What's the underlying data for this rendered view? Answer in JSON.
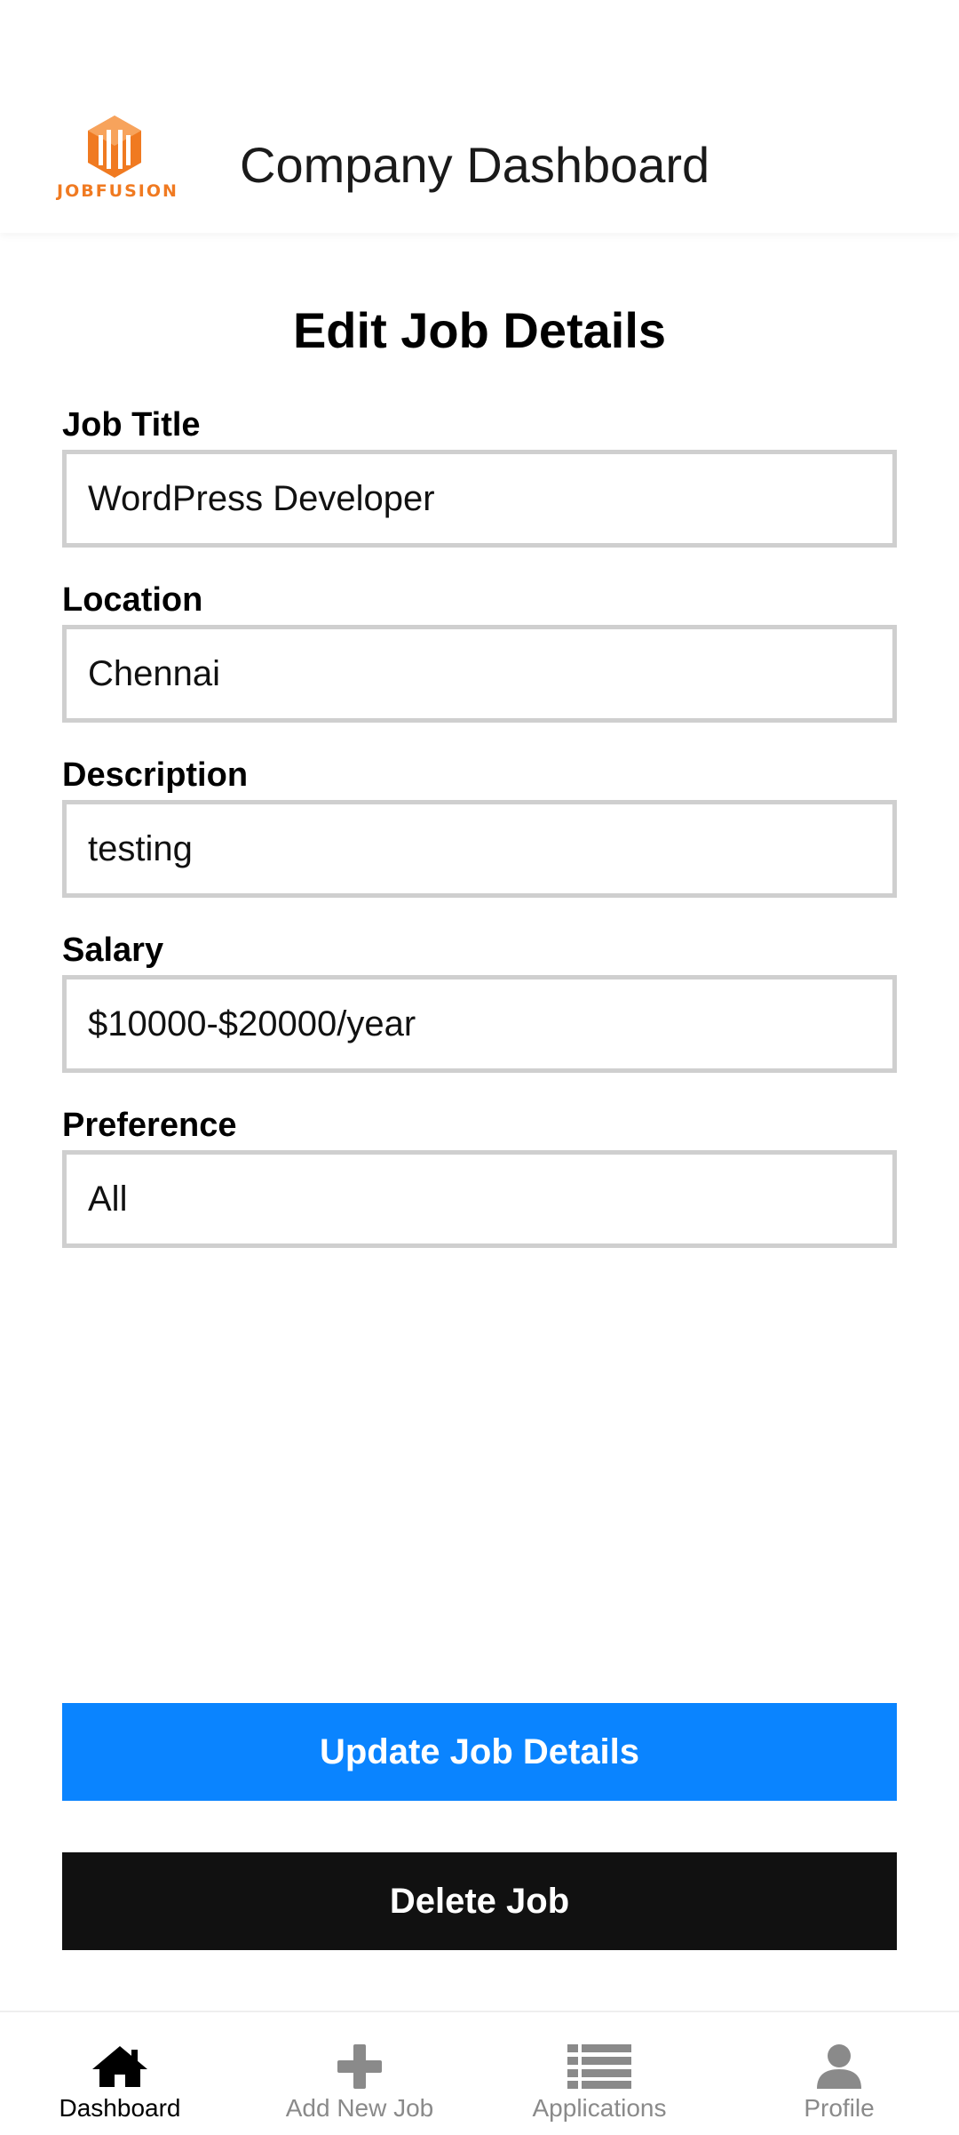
{
  "header": {
    "logo_text": "JOBFUSION",
    "title": "Company Dashboard"
  },
  "page": {
    "heading": "Edit Job Details"
  },
  "form": {
    "job_title": {
      "label": "Job Title",
      "value": "WordPress Developer"
    },
    "location": {
      "label": "Location",
      "value": "Chennai"
    },
    "description": {
      "label": "Description",
      "value": "testing"
    },
    "salary": {
      "label": "Salary",
      "value": "$10000-$20000/year"
    },
    "preference": {
      "label": "Preference",
      "value": "All"
    }
  },
  "actions": {
    "update_label": "Update Job Details",
    "delete_label": "Delete Job"
  },
  "bottom_nav": {
    "items": [
      {
        "label": "Dashboard",
        "icon": "home-icon",
        "active": true
      },
      {
        "label": "Add New Job",
        "icon": "plus-icon",
        "active": false
      },
      {
        "label": "Applications",
        "icon": "list-icon",
        "active": false
      },
      {
        "label": "Profile",
        "icon": "user-icon",
        "active": false
      }
    ]
  },
  "colors": {
    "accent": "#0a84ff",
    "delete": "#111111",
    "logo": "#f07a21",
    "nav_active": "#000000",
    "nav_inactive": "#8a8a8a"
  }
}
